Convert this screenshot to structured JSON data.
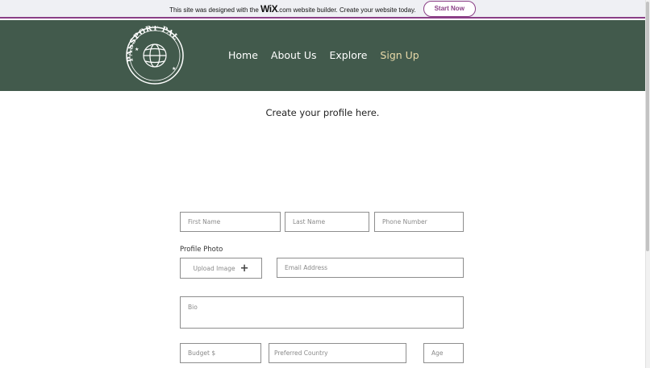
{
  "banner": {
    "text_before": "This site was designed with the ",
    "wix_logo": "WiX",
    "text_after": ".com website builder. Create your website today.",
    "cta_label": "Start Now"
  },
  "header": {
    "logo_text": "PASSPORT PAL",
    "nav": [
      {
        "label": "Home",
        "active": false
      },
      {
        "label": "About Us",
        "active": false
      },
      {
        "label": "Explore",
        "active": false
      },
      {
        "label": "Sign Up",
        "active": true
      }
    ]
  },
  "main": {
    "title": "Create your profile here.",
    "profile_photo_label": "Profile Photo",
    "upload_label": "Upload Image",
    "fields": {
      "first_name": "First Name",
      "last_name": "Last Name",
      "phone_number": "Phone Number",
      "email": "Email Address",
      "bio": "Bio",
      "budget": "Budget $",
      "preferred_country": "Preferred Country",
      "age": "Age"
    }
  },
  "colors": {
    "header_bg": "#425a4c",
    "accent": "#8a3f86",
    "active_nav": "#e8d9a8"
  },
  "icons": [
    "globe-icon",
    "star-icon",
    "plus-icon"
  ]
}
